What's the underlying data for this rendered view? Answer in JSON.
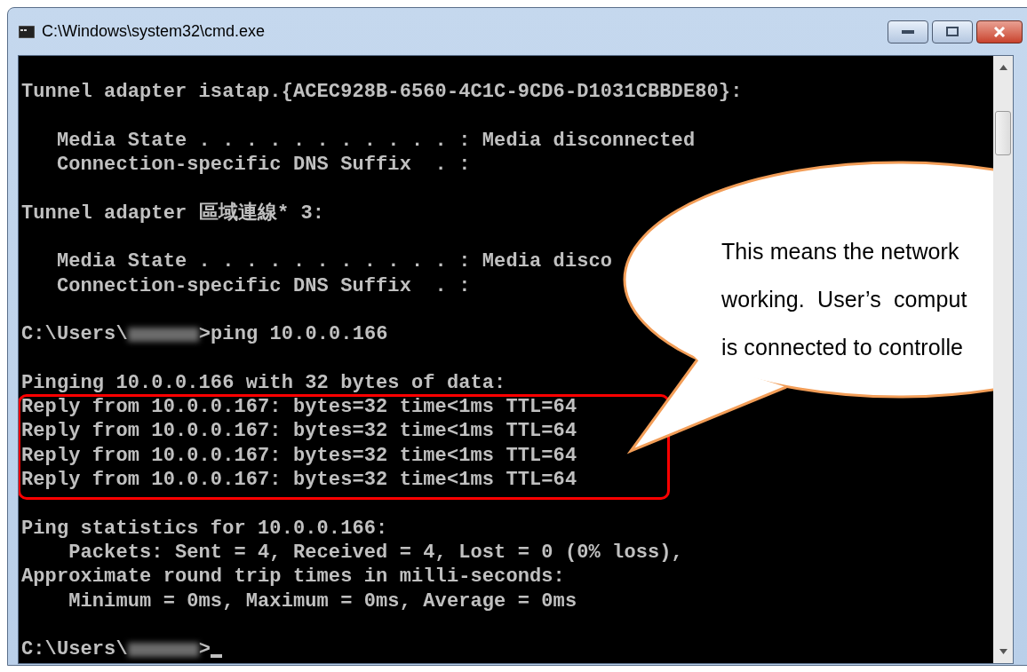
{
  "window": {
    "title": "C:\\Windows\\system32\\cmd.exe"
  },
  "console": {
    "blocks": [
      {
        "highlighted": false,
        "lines": [
          {
            "kind": "blank"
          },
          {
            "kind": "text",
            "text": "Tunnel adapter isatap.{ACEC928B-6560-4C1C-9CD6-D1031CBBDE80}:"
          },
          {
            "kind": "blank"
          },
          {
            "kind": "text",
            "text": "   Media State . . . . . . . . . . . : Media disconnected"
          },
          {
            "kind": "text",
            "text": "   Connection-specific DNS Suffix  . :"
          },
          {
            "kind": "blank"
          },
          {
            "kind": "text",
            "text": "Tunnel adapter 區域連線* 3:"
          },
          {
            "kind": "blank"
          },
          {
            "kind": "text",
            "text": "   Media State . . . . . . . . . . . : Media disco"
          },
          {
            "kind": "text",
            "text": "   Connection-specific DNS Suffix  . :"
          },
          {
            "kind": "blank"
          },
          {
            "kind": "prompt",
            "prefix": "C:\\Users\\",
            "suffix": ">ping 10.0.0.166",
            "cursor": false
          },
          {
            "kind": "blank"
          },
          {
            "kind": "text",
            "text": "Pinging 10.0.0.166 with 32 bytes of data:"
          }
        ]
      },
      {
        "highlighted": true,
        "lines": [
          {
            "kind": "text",
            "text": "Reply from 10.0.0.167: bytes=32 time<1ms TTL=64"
          },
          {
            "kind": "text",
            "text": "Reply from 10.0.0.167: bytes=32 time<1ms TTL=64"
          },
          {
            "kind": "text",
            "text": "Reply from 10.0.0.167: bytes=32 time<1ms TTL=64"
          },
          {
            "kind": "text",
            "text": "Reply from 10.0.0.167: bytes=32 time<1ms TTL=64"
          }
        ]
      },
      {
        "highlighted": false,
        "lines": [
          {
            "kind": "blank"
          },
          {
            "kind": "text",
            "text": "Ping statistics for 10.0.0.166:"
          },
          {
            "kind": "text",
            "text": "    Packets: Sent = 4, Received = 4, Lost = 0 (0% loss),"
          },
          {
            "kind": "text",
            "text": "Approximate round trip times in milli-seconds:"
          },
          {
            "kind": "text",
            "text": "    Minimum = 0ms, Maximum = 0ms, Average = 0ms"
          },
          {
            "kind": "blank"
          },
          {
            "kind": "prompt",
            "prefix": "C:\\Users\\",
            "suffix": ">",
            "cursor": true
          }
        ]
      }
    ]
  },
  "callout": {
    "lines": [
      "This means the network",
      "working.  User’s  comput",
      "is connected to controlle"
    ]
  }
}
